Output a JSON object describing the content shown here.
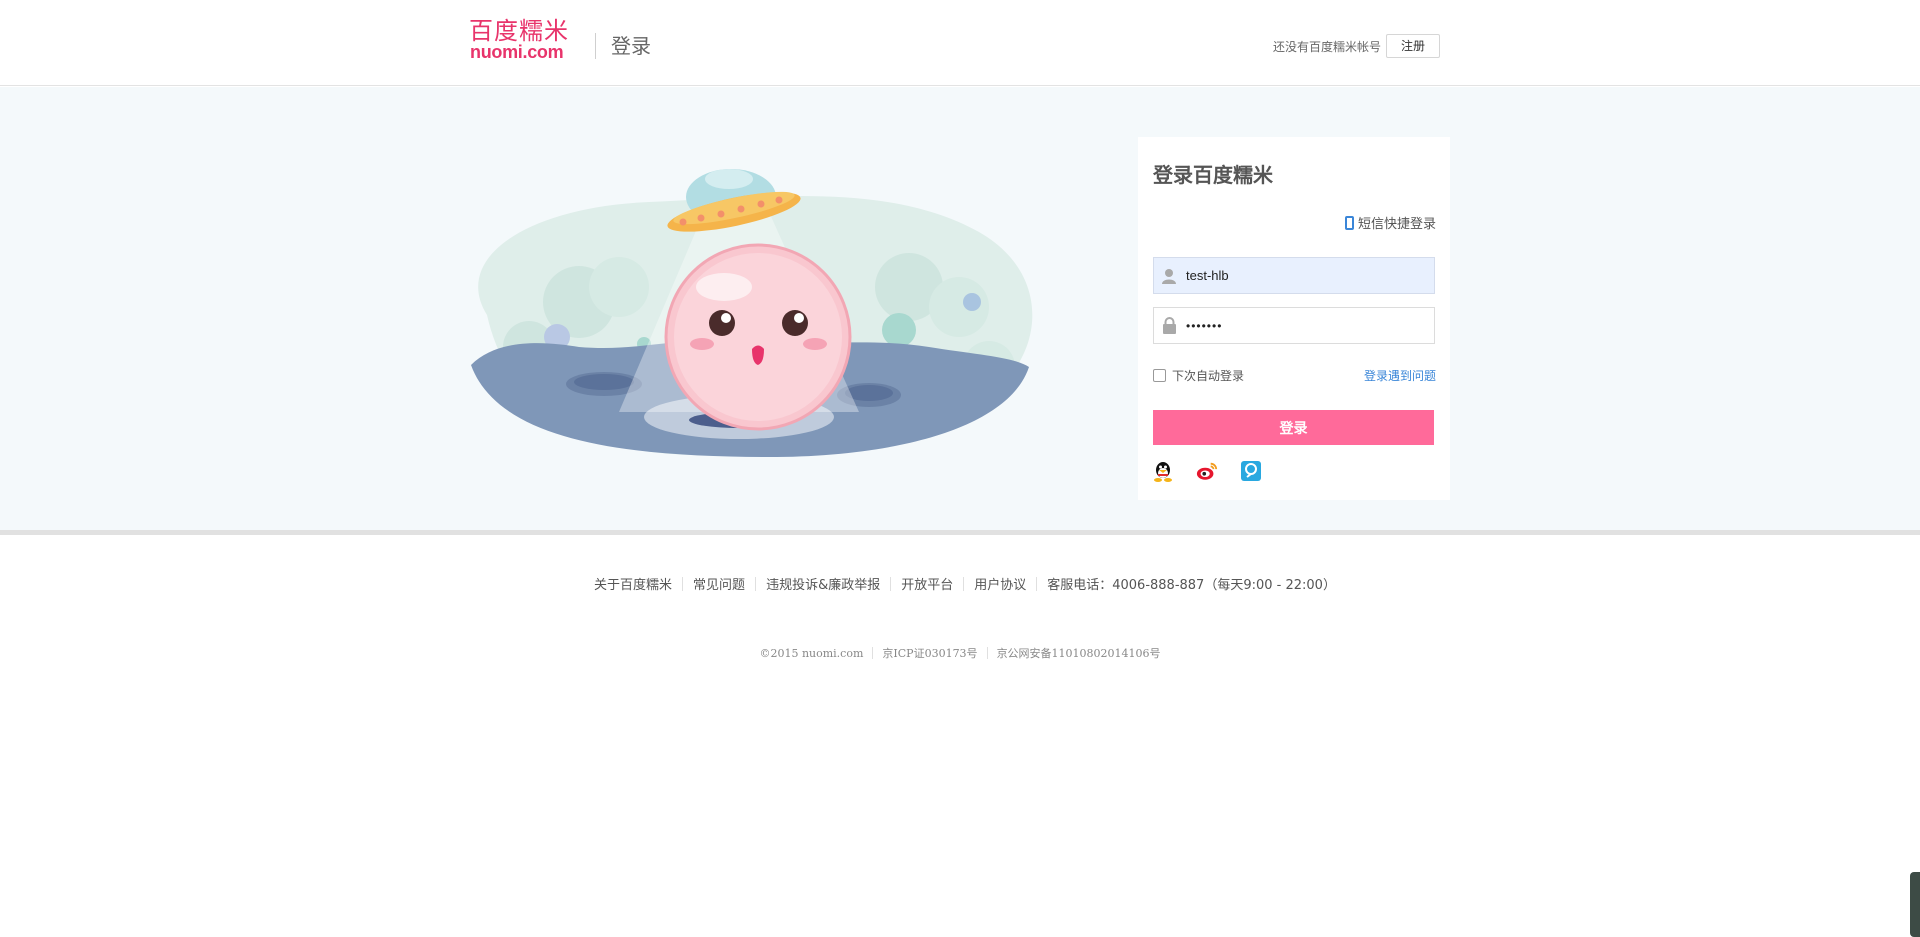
{
  "header": {
    "logo_cn": "百度糯米",
    "logo_en": "nuomi.com",
    "title": "登录",
    "no_account_hint": "还没有百度糯米帐号",
    "register_label": "注册"
  },
  "login": {
    "title": "登录百度糯米",
    "sms_login_label": "短信快捷登录",
    "username_value": "test-hlb",
    "password_value": "•••••••",
    "remember_label": "下次自动登录",
    "problem_label": "登录遇到问题",
    "submit_label": "登录",
    "socials": [
      {
        "name": "qq-icon"
      },
      {
        "name": "weibo-icon"
      },
      {
        "name": "baidu-icon"
      }
    ]
  },
  "footer": {
    "links": [
      "关于百度糯米",
      "常见问题",
      "违规投诉&廉政举报",
      "开放平台",
      "用户协议"
    ],
    "service_phone": "客服电话：4006-888-887（每天9:00 - 22:00）",
    "copyright": "©2015 nuomi.com",
    "icp": "京ICP证030173号",
    "police": "京公网安备11010802014106号"
  },
  "colors": {
    "brand": "#e8346b",
    "login_button": "#ff6a9a",
    "link": "#3a86d8",
    "band_bg": "#f4f9fb"
  }
}
